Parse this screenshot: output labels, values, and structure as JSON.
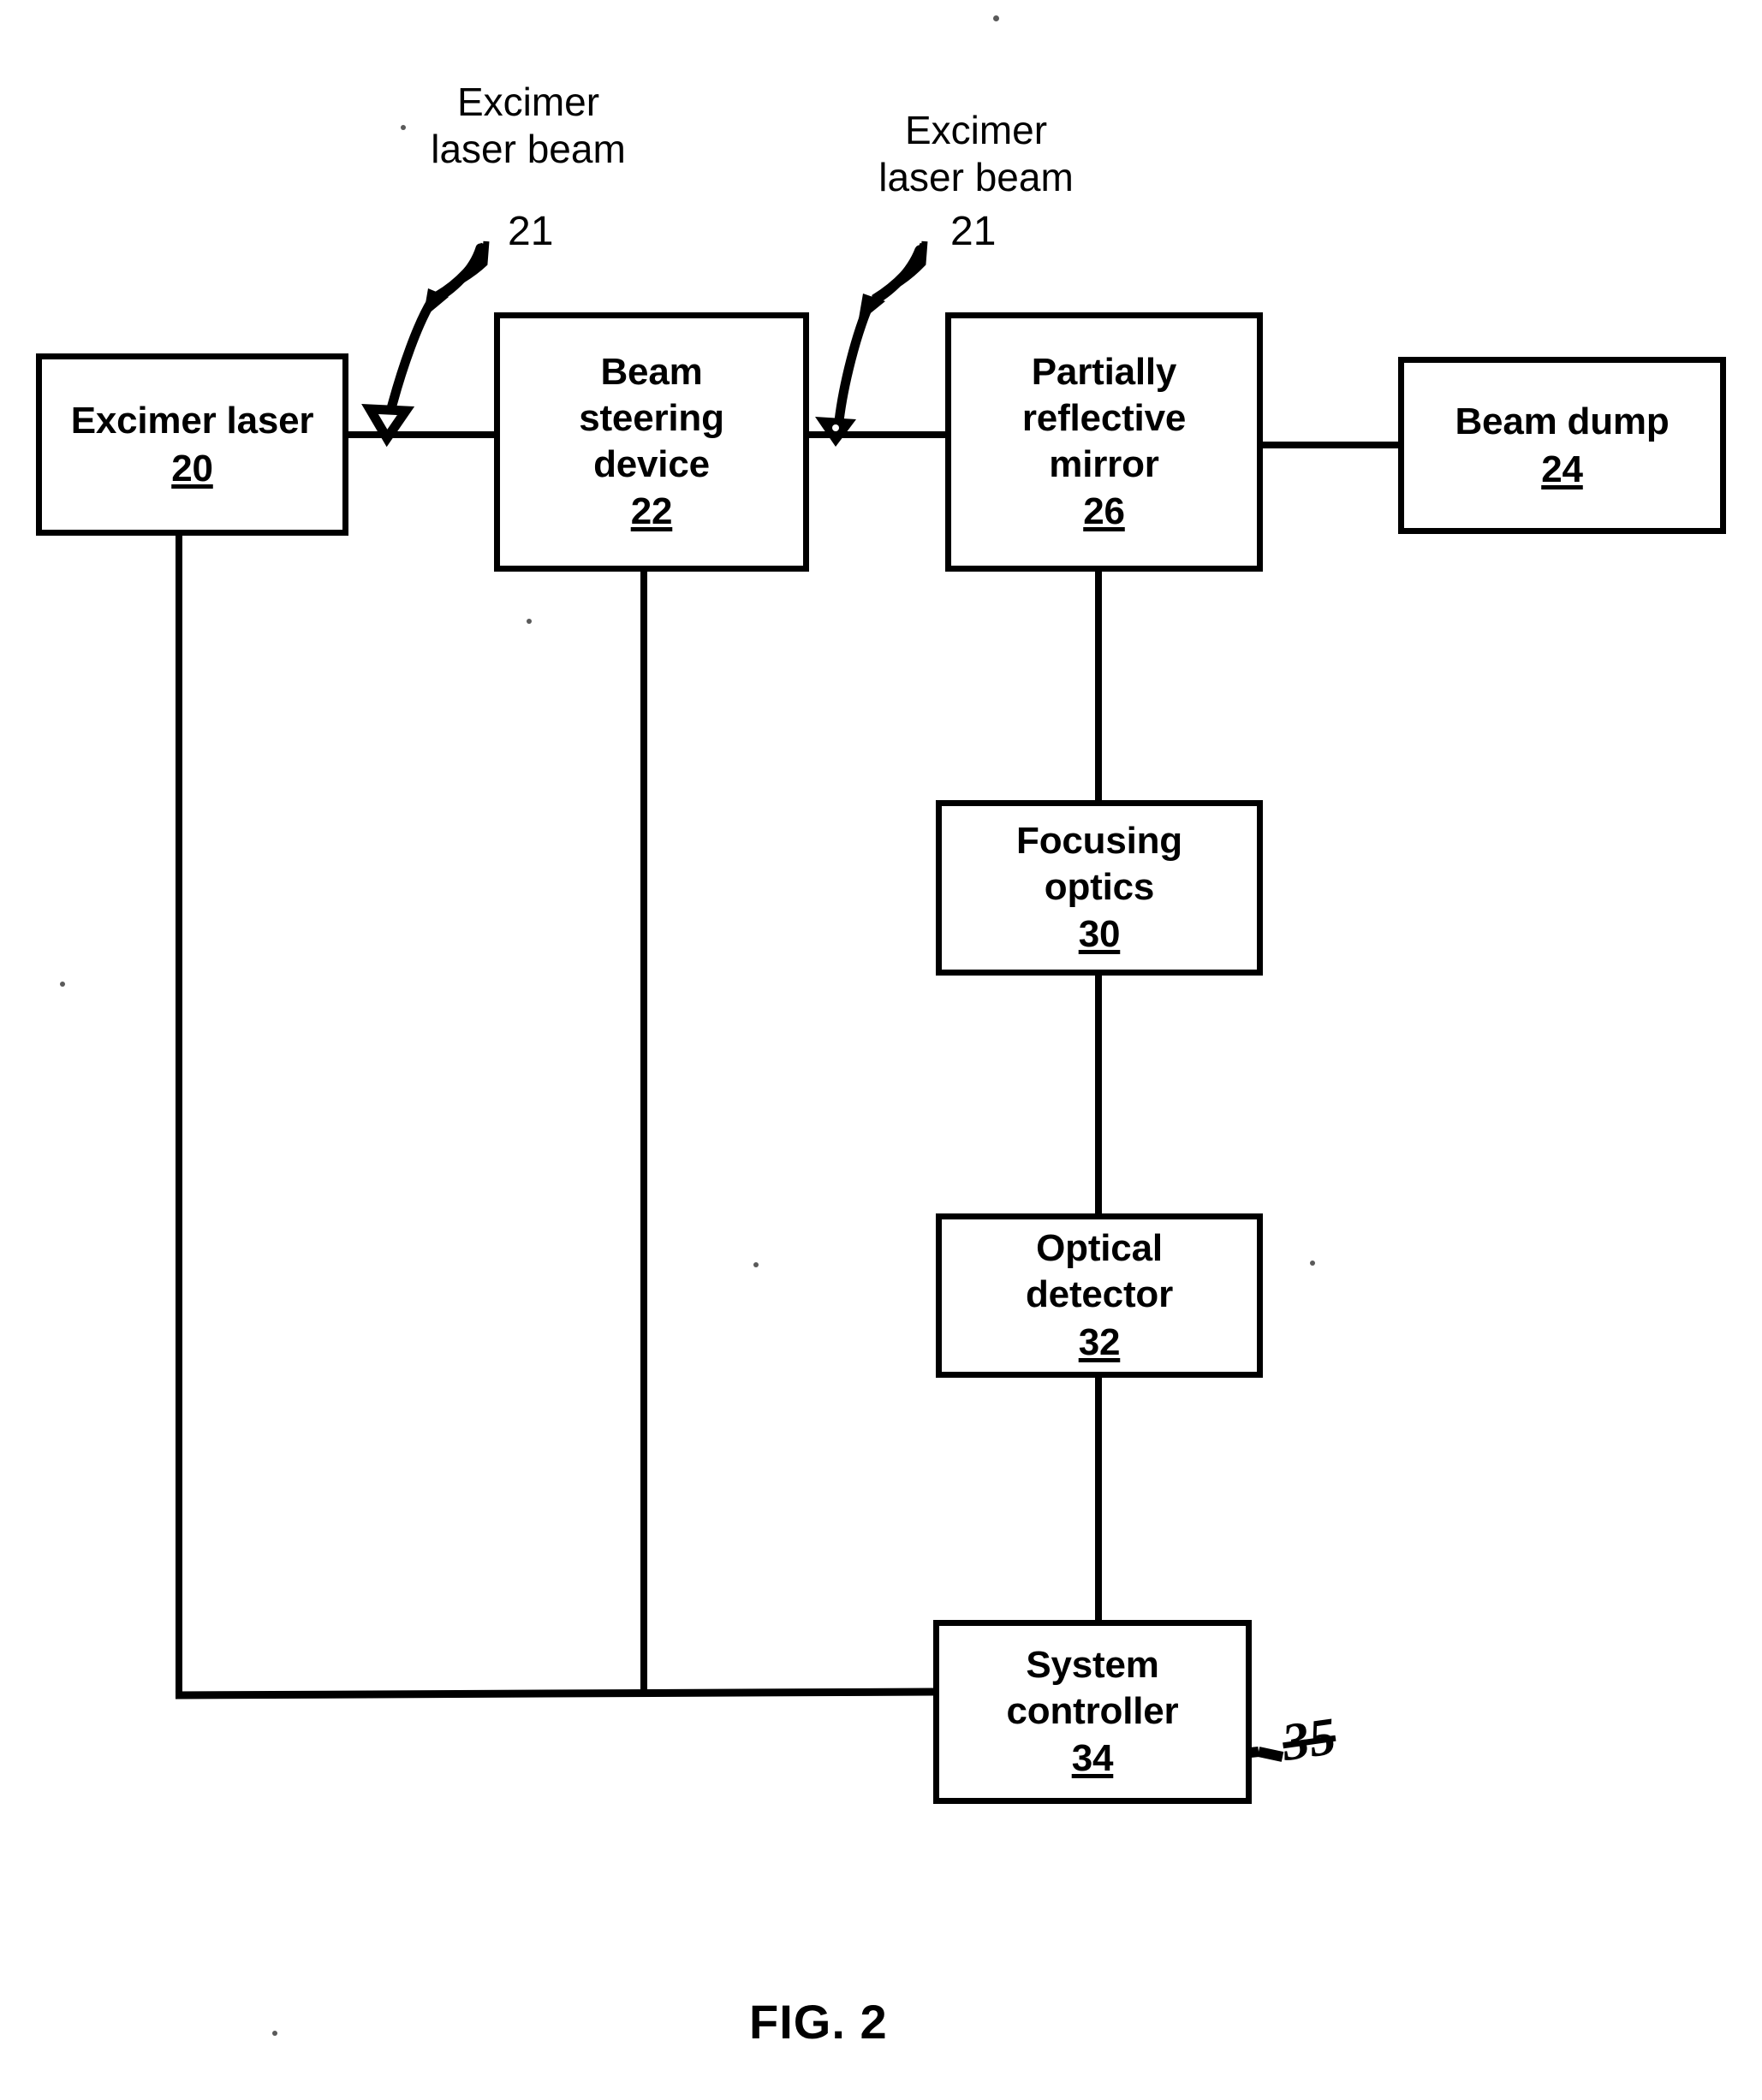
{
  "figure": {
    "caption": "FIG. 2",
    "type": "patent-block-diagram"
  },
  "callouts": [
    {
      "id": "callout-left",
      "label": "Excimer\nlaser beam",
      "ref": "21",
      "arrow": "curved-arrow-to-beam-path-icon"
    },
    {
      "id": "callout-right",
      "label": "Excimer\nlaser beam",
      "ref": "21",
      "arrow": "curved-arrow-to-beam-path-icon"
    }
  ],
  "blocks": [
    {
      "id": "excimer-laser",
      "label": "Excimer laser",
      "ref": "20"
    },
    {
      "id": "beam-steering",
      "label": "Beam\nsteering\ndevice",
      "ref": "22"
    },
    {
      "id": "partial-mirror",
      "label": "Partially\nreflective\nmirror",
      "ref": "26"
    },
    {
      "id": "beam-dump",
      "label": "Beam dump",
      "ref": "24"
    },
    {
      "id": "focusing-optics",
      "label": "Focusing\noptics",
      "ref": "30"
    },
    {
      "id": "optical-detector",
      "label": "Optical\ndetector",
      "ref": "32"
    },
    {
      "id": "system-controller",
      "label": "System\ncontroller",
      "ref": "34"
    }
  ],
  "annotations": [
    {
      "id": "controller-port",
      "ref": "35",
      "icon": "hand-drawn-connector-block-icon",
      "style": "handwritten"
    }
  ],
  "colors": {
    "ink": "#000000",
    "page": "#ffffff"
  }
}
